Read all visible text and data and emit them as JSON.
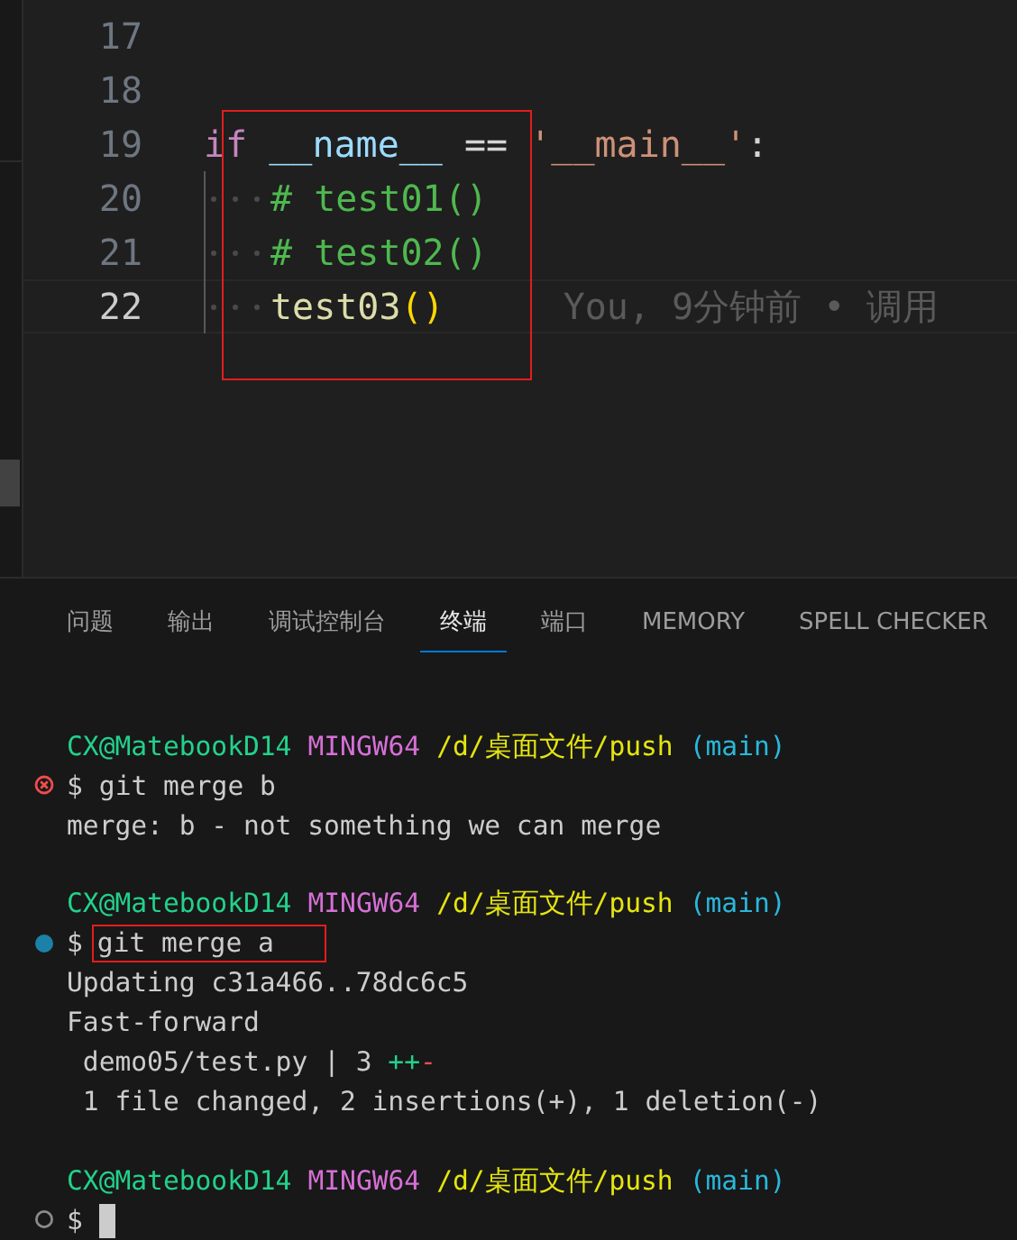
{
  "editor": {
    "lines": [
      {
        "number": "17",
        "current": false,
        "indented": false
      },
      {
        "number": "18",
        "current": false,
        "indented": false
      },
      {
        "number": "19",
        "current": false,
        "indented": false,
        "tokens": [
          {
            "text": "if",
            "kind": "keyword"
          },
          {
            "text": " __name__",
            "kind": "variable"
          },
          {
            "text": " ==",
            "kind": "operator"
          },
          {
            "text": " '__main__'",
            "kind": "string"
          },
          {
            "text": ":",
            "kind": "punct"
          }
        ]
      },
      {
        "number": "20",
        "current": false,
        "indented": true,
        "tokens": [
          {
            "text": "# test01()",
            "kind": "comment"
          }
        ]
      },
      {
        "number": "21",
        "current": false,
        "indented": true,
        "tokens": [
          {
            "text": "# test02()",
            "kind": "comment"
          }
        ]
      },
      {
        "number": "22",
        "current": true,
        "indented": true,
        "tokens": [
          {
            "text": "test03",
            "kind": "function"
          },
          {
            "text": "()",
            "kind": "bracket"
          }
        ],
        "blame": "You, 9分钟前 • 调用"
      }
    ]
  },
  "panel": {
    "tabs": [
      {
        "label": "问题",
        "selected": false
      },
      {
        "label": "输出",
        "selected": false
      },
      {
        "label": "调试控制台",
        "selected": false
      },
      {
        "label": "终端",
        "selected": true
      },
      {
        "label": "端口",
        "selected": false
      },
      {
        "label": "MEMORY",
        "selected": false
      },
      {
        "label": "SPELL CHECKER",
        "selected": false
      }
    ]
  },
  "terminal": {
    "lines": [
      {
        "kind": "prompt",
        "user": "CX@MatebookD14",
        "system": "MINGW64",
        "path": "/d/桌面文件/push",
        "branch": "(main)"
      },
      {
        "kind": "command",
        "marker": {
          "kind": "error"
        },
        "symbol": "$",
        "text": "git merge b",
        "outlined": false,
        "cursor": false
      },
      {
        "kind": "output",
        "segments": [
          {
            "text": "merge: b - not something we can merge",
            "kind": "plain"
          }
        ]
      },
      {
        "kind": "blank"
      },
      {
        "kind": "prompt",
        "user": "CX@MatebookD14",
        "system": "MINGW64",
        "path": "/d/桌面文件/push",
        "branch": "(main)"
      },
      {
        "kind": "command",
        "marker": {
          "kind": "success"
        },
        "symbol": "$",
        "text": "git merge a",
        "outlined": true,
        "cursor": false
      },
      {
        "kind": "output",
        "segments": [
          {
            "text": "Updating c31a466..78dc6c5",
            "kind": "plain"
          }
        ]
      },
      {
        "kind": "output",
        "segments": [
          {
            "text": "Fast-forward",
            "kind": "plain"
          }
        ]
      },
      {
        "kind": "output",
        "segments": [
          {
            "text": " demo05/test.py | 3 ",
            "kind": "plain"
          },
          {
            "text": "++",
            "kind": "added"
          },
          {
            "text": "-",
            "kind": "deleted"
          }
        ]
      },
      {
        "kind": "output",
        "segments": [
          {
            "text": " 1 file changed, 2 insertions(+), 1 deletion(-)",
            "kind": "plain"
          }
        ]
      },
      {
        "kind": "blank"
      },
      {
        "kind": "prompt",
        "user": "CX@MatebookD14",
        "system": "MINGW64",
        "path": "/d/桌面文件/push",
        "branch": "(main)"
      },
      {
        "kind": "command",
        "marker": {
          "kind": "pending"
        },
        "symbol": "$",
        "cursor": true
      }
    ]
  }
}
